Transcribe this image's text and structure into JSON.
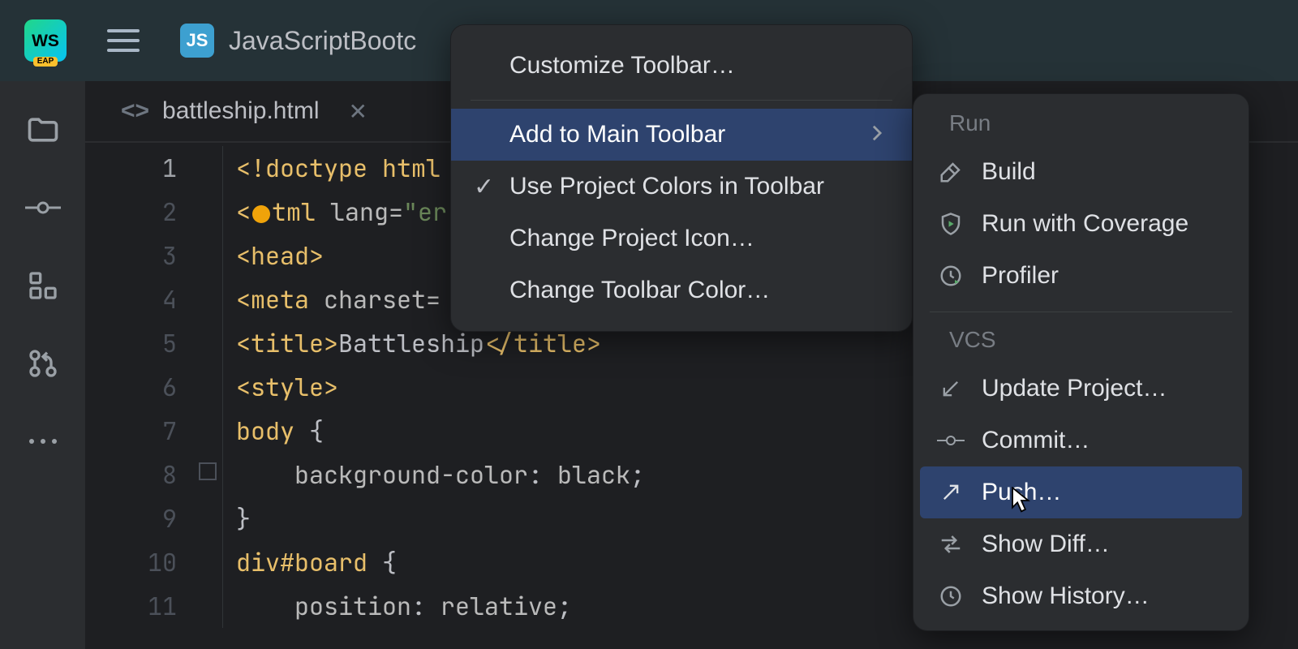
{
  "toolbar": {
    "ide_label": "WS",
    "ide_badge": "EAP",
    "project_type": "JS",
    "project_name": "JavaScriptBootc"
  },
  "tab": {
    "filename": "battleship.html"
  },
  "gutter": [
    "1",
    "2",
    "3",
    "4",
    "5",
    "6",
    "7",
    "8",
    "9",
    "10",
    "11"
  ],
  "code": {
    "l1a": "<!doctype ",
    "l1b": "html",
    "l2a": "<",
    "l2b": "tml",
    "l2c": " lang=",
    "l2d": "\"er",
    "l3a": "<head>",
    "l4a": "<meta",
    "l4b": " charset=",
    "l5a": "<title>",
    "l5b": "Battleship",
    "l5c": "</title>",
    "l6a": "<style>",
    "l7a": "body ",
    "l7b": "{",
    "l8a": "    background-color",
    "l8b": ": ",
    "l8c": "black",
    "l8d": ";",
    "l9a": "}",
    "l10a": "div",
    "l10b": "#board ",
    "l10c": "{",
    "l11a": "    position",
    "l11b": ": ",
    "l11c": "relative",
    "l11d": ";"
  },
  "context_menu": {
    "customize": "Customize Toolbar…",
    "add_main": "Add to Main Toolbar",
    "use_colors": "Use Project Colors in Toolbar",
    "change_icon": "Change Project Icon…",
    "change_color": "Change Toolbar Color…"
  },
  "submenu": {
    "run_header": "Run",
    "build": "Build",
    "coverage": "Run with Coverage",
    "profiler": "Profiler",
    "vcs_header": "VCS",
    "update": "Update Project…",
    "commit": "Commit…",
    "push": "Push…",
    "diff": "Show Diff…",
    "history": "Show History…"
  }
}
